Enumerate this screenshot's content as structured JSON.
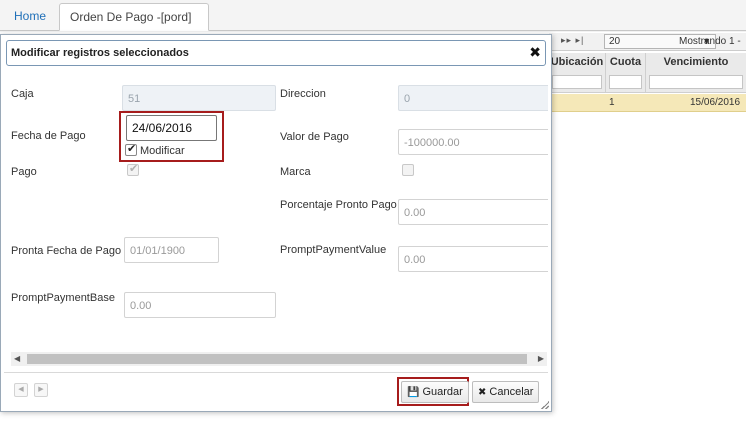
{
  "tabs": {
    "home_label": "Home",
    "active_label": "Orden De Pago -[pord]",
    "close_glyph": "×"
  },
  "grid": {
    "pager_nav": "▸▸ ▸|",
    "page_size": "20",
    "showing": "Mostrando 1 -",
    "columns": [
      "Ubicación",
      "Cuota",
      "Vencimiento"
    ],
    "row": {
      "cuota": "1",
      "vencimiento": "15/06/2016"
    }
  },
  "modal": {
    "title": "Modificar registros seleccionados",
    "close_glyph": "✖",
    "fields": {
      "caja": {
        "label": "Caja",
        "value": "51"
      },
      "direccion": {
        "label": "Direccion",
        "value": "0"
      },
      "fecha_pago": {
        "label": "Fecha de Pago",
        "value": "24/06/2016",
        "modify_label": "Modificar",
        "modify_checked": true
      },
      "valor_pago": {
        "label": "Valor de Pago",
        "value": "-100000.00"
      },
      "pago": {
        "label": "Pago",
        "checked": true
      },
      "marca": {
        "label": "Marca",
        "checked": false
      },
      "porcentaje_pronto_pago": {
        "label": "Porcentaje Pronto Pago",
        "value": "0.00"
      },
      "pronta_fecha_pago": {
        "label": "Pronta Fecha de Pago",
        "value": "01/01/1900"
      },
      "prompt_payment_value": {
        "label": "PromptPaymentValue",
        "value": "0.00"
      },
      "prompt_payment_base": {
        "label": "PromptPaymentBase",
        "value": "0.00"
      }
    },
    "footer": {
      "save_label": "Guardar",
      "cancel_label": "Cancelar"
    }
  },
  "colors": {
    "link_blue": "#1f6fb8",
    "highlight_red": "#a61c1c",
    "selected_row": "#f5e8b8",
    "disabled_field": "#eef2f6"
  },
  "icons": [
    "close-icon",
    "save-icon",
    "cancel-icon",
    "first-page-icon",
    "last-page-icon",
    "dropdown-caret-icon",
    "scroll-left-icon",
    "scroll-right-icon",
    "resize-grip-icon"
  ]
}
